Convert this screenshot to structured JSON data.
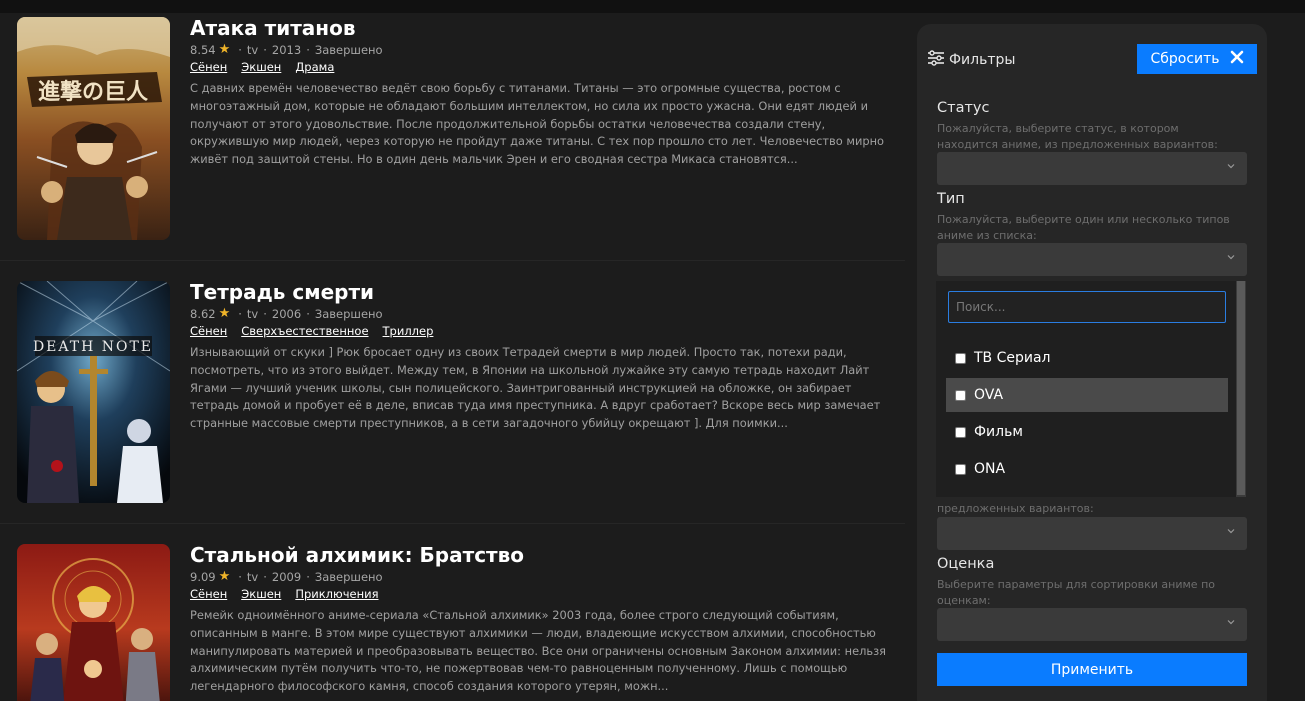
{
  "anime": [
    {
      "title": "Атака титанов",
      "rating": "8.54",
      "type": "tv",
      "year": "2013",
      "status": "Завершено",
      "genres": [
        "Сёнен",
        "Экшен",
        "Драма"
      ],
      "description": "С давних времён человечество ведёт свою борьбу с титанами. Титаны — это огромные существа, ростом с многоэтажный дом, которые не обладают большим интеллектом, но сила их просто ужасна. Они едят людей и получают от этого удовольствие. После продолжительной борьбы остатки человечества создали стену, окружившую мир людей, через которую не пройдут даже титаны. С тех пор прошло сто лет. Человечество мирно живёт под защитой стены. Но в один день мальчик Эрен и его сводная сестра Микаса становятся..."
    },
    {
      "title": "Тетрадь смерти",
      "rating": "8.62",
      "type": "tv",
      "year": "2006",
      "status": "Завершено",
      "genres": [
        "Сёнен",
        "Сверхъестественное",
        "Триллер"
      ],
      "description": "Изнывающий от скуки ] Рюк бросает одну из своих Тетрадей смерти в мир людей. Просто так, потехи ради, посмотреть, что из этого выйдет. Между тем, в Японии на школьной лужайке эту самую тетрадь находит Лайт Ягами — лучший ученик школы, сын полицейского. Заинтригованный инструкцией на обложке, он забирает тетрадь домой и пробует её в деле, вписав туда имя преступника. А вдруг сработает? Вскоре весь мир замечает странные массовые смерти преступников, а в сети загадочного убийцу окрещают ]. Для поимки..."
    },
    {
      "title": "Стальной алхимик: Братство",
      "rating": "9.09",
      "type": "tv",
      "year": "2009",
      "status": "Завершено",
      "genres": [
        "Сёнен",
        "Экшен",
        "Приключения"
      ],
      "description": "Ремейк одноимённого аниме-сериала «Стальной алхимик» 2003 года, более строго следующий событиям, описанным в манге. В этом мире существуют алхимики — люди, владеющие искусством алхимии, способностью манипулировать материей и преобразовывать вещество. Все они ограничены основным Законом алхимии: нельзя алхимическим путём получить что-то, не пожертвовав чем-то равноценным полученному. Лишь с помощью легендарного философского камня, способ создания которого утерян, можн..."
    }
  ],
  "filters": {
    "title": "Фильтры",
    "reset_label": "Сбросить",
    "status_label": "Статус",
    "status_hint": "Пожалуйста, выберите статус, в котором находится аниме, из предложенных вариантов:",
    "type_label": "Тип",
    "type_hint": "Пожалуйста, выберите один или несколько типов аниме из списка:",
    "hidden_hint": "предложенных вариантов:",
    "rating_label": "Оценка",
    "rating_hint": "Выберите параметры для сортировки аниме по оценкам:",
    "apply_label": "Применить"
  },
  "dropdown": {
    "search_placeholder": "Поиск...",
    "options": [
      "ТВ Сериал",
      "OVA",
      "Фильм",
      "ONA"
    ],
    "highlighted": "OVA"
  },
  "colors": {
    "accent": "#0a7cff",
    "star": "#f0b429",
    "background": "#1c1c1c",
    "panel": "#262626"
  }
}
